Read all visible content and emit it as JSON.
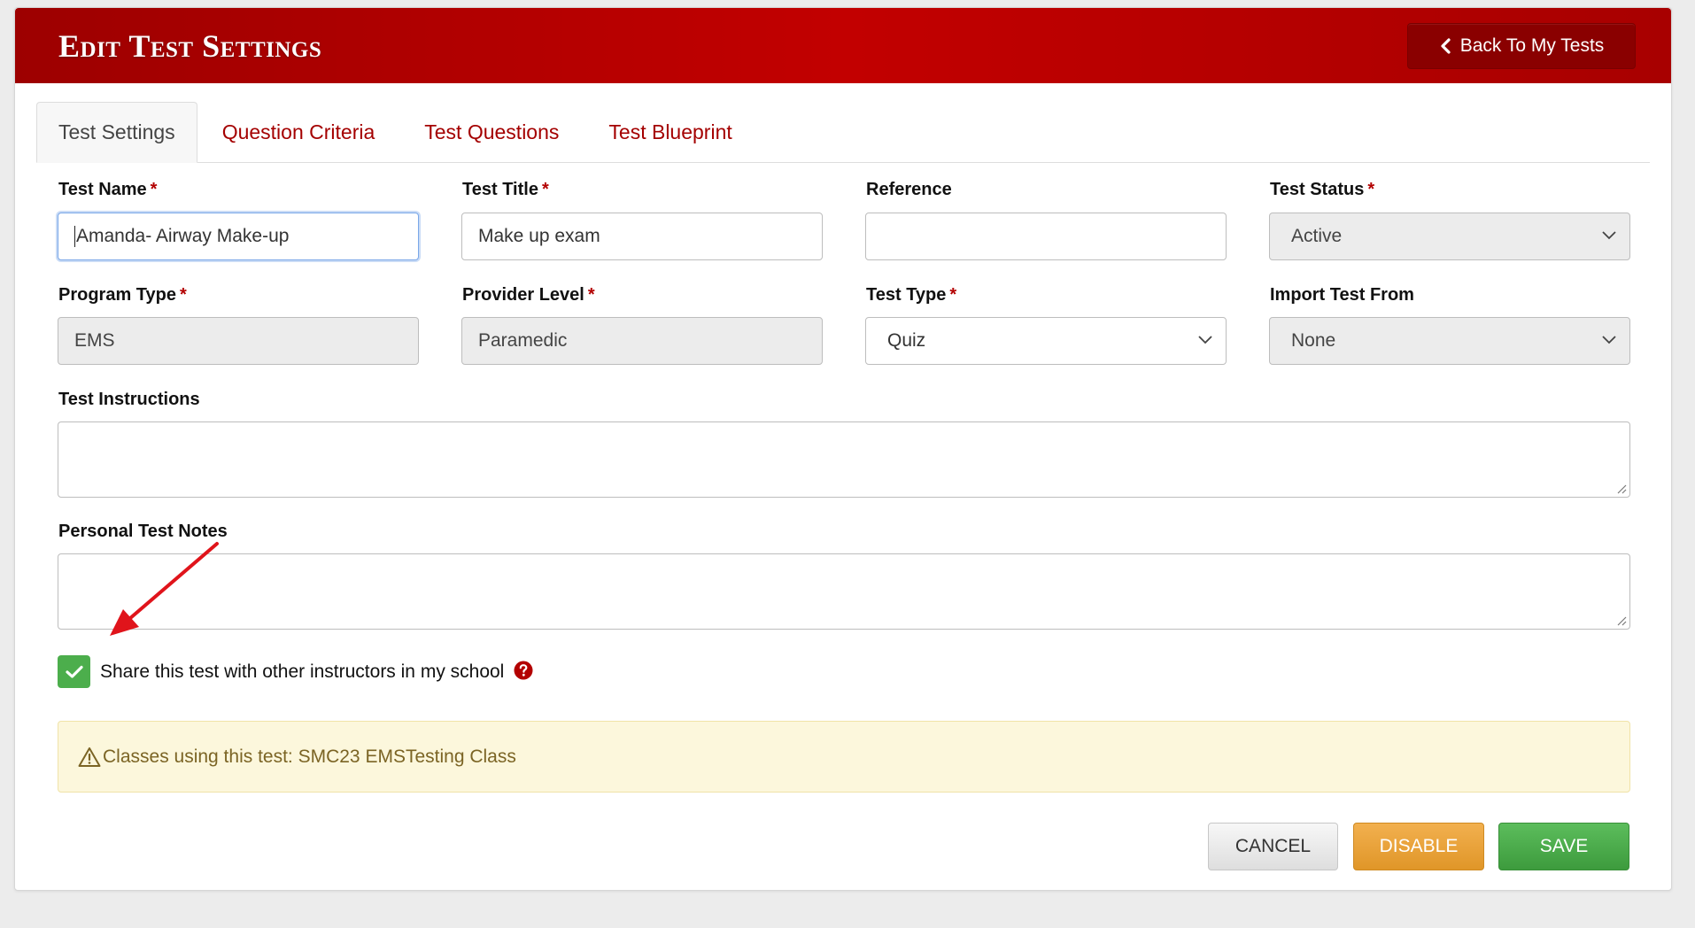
{
  "header": {
    "title": "Edit Test Settings",
    "back_label": "Back To My Tests",
    "colors": {
      "header": "#b00000",
      "accent": "#a40000"
    }
  },
  "tabs": [
    {
      "label": "Test Settings",
      "active": true
    },
    {
      "label": "Question Criteria",
      "active": false
    },
    {
      "label": "Test Questions",
      "active": false
    },
    {
      "label": "Test Blueprint",
      "active": false
    }
  ],
  "form": {
    "required_mark": "*",
    "test_name": {
      "label": "Test Name",
      "value": "Amanda- Airway Make-up"
    },
    "test_title": {
      "label": "Test Title",
      "value": "Make up exam"
    },
    "reference": {
      "label": "Reference",
      "value": ""
    },
    "test_status": {
      "label": "Test Status",
      "value": "Active"
    },
    "program_type": {
      "label": "Program Type",
      "value": "EMS"
    },
    "provider_level": {
      "label": "Provider Level",
      "value": "Paramedic"
    },
    "test_type": {
      "label": "Test Type",
      "value": "Quiz"
    },
    "import_test_from": {
      "label": "Import Test From",
      "value": "None"
    },
    "test_instructions": {
      "label": "Test Instructions",
      "value": ""
    },
    "personal_test_notes": {
      "label": "Personal Test Notes",
      "value": ""
    },
    "share": {
      "label": "Share this test with other instructors in my school",
      "checked": true
    }
  },
  "alert": {
    "text": "Classes using this test: SMC23 EMSTesting Class",
    "icon": "warning-icon"
  },
  "buttons": {
    "cancel": "Cancel",
    "disable": "Disable",
    "save": "Save"
  }
}
